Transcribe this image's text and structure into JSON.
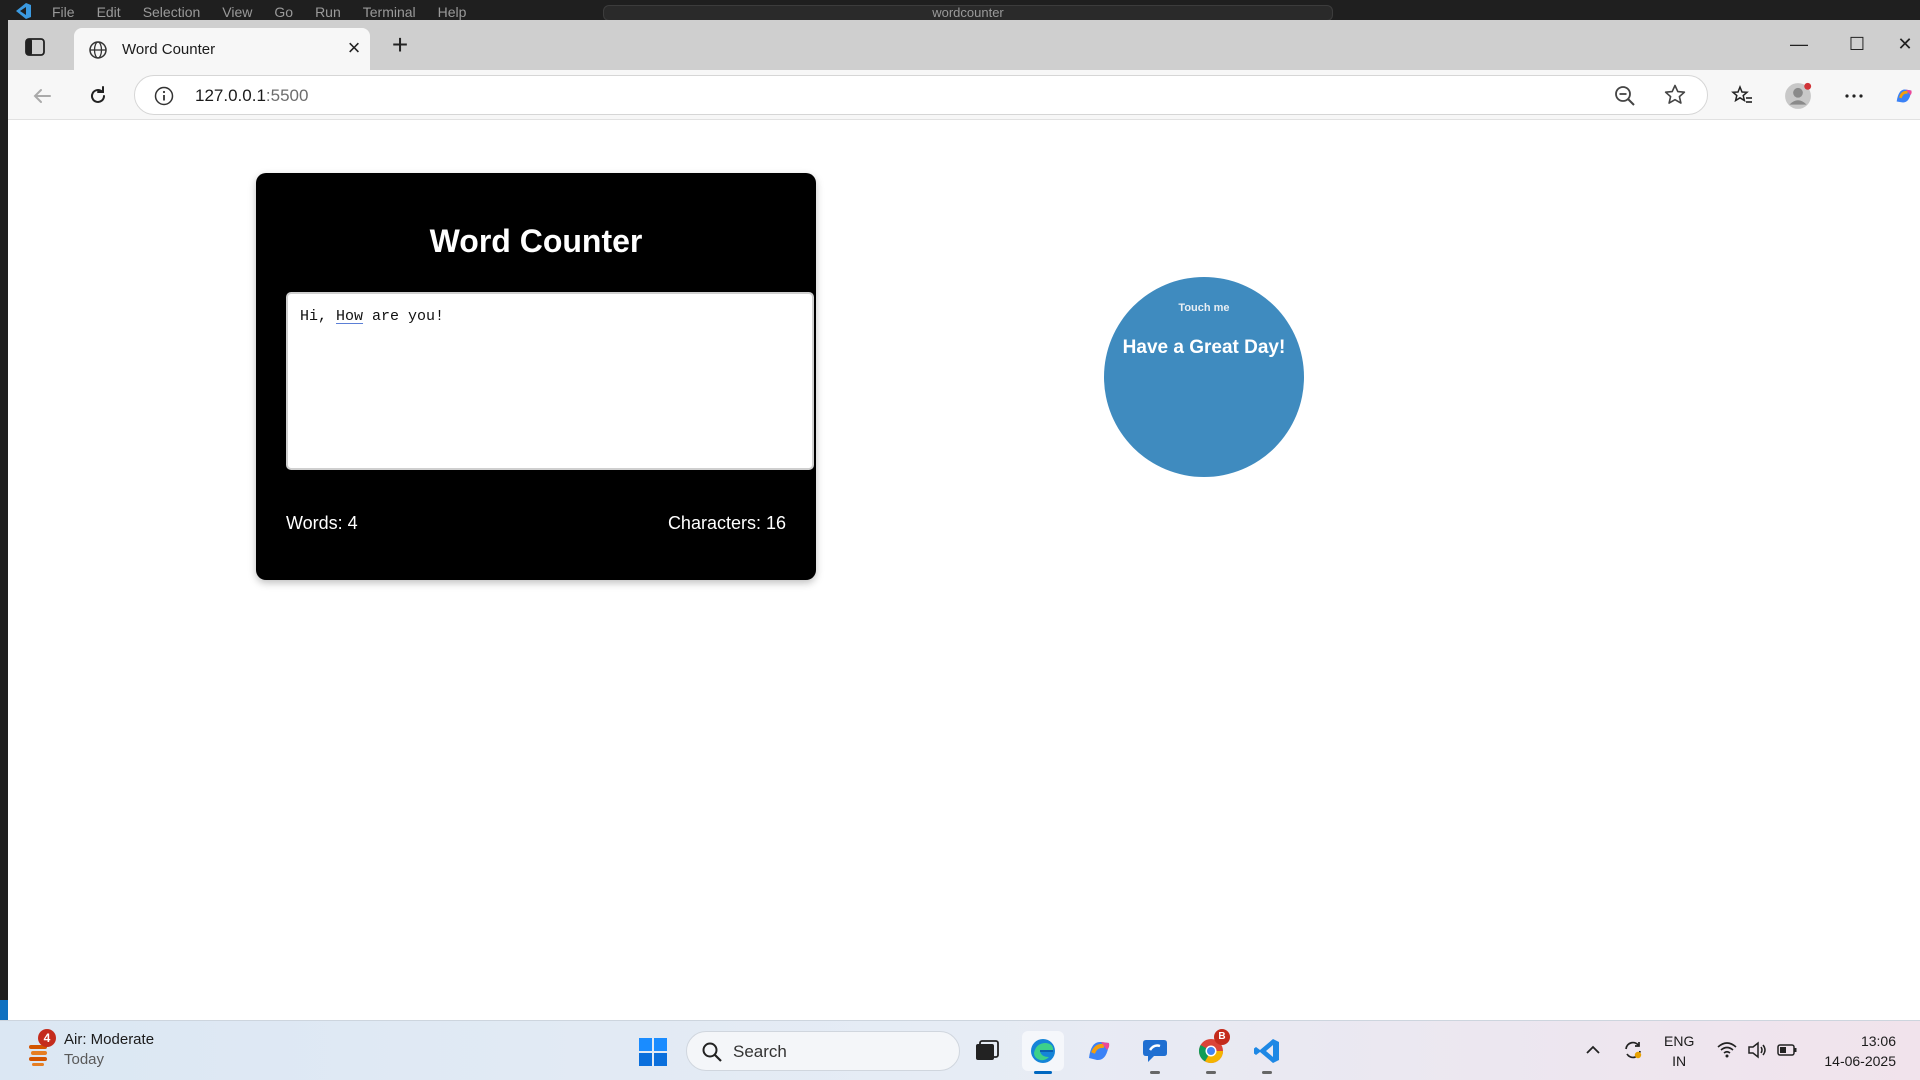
{
  "vscode": {
    "menu": [
      "File",
      "Edit",
      "Selection",
      "View",
      "Go",
      "Run",
      "Terminal",
      "Help"
    ],
    "search_text": "wordcounter"
  },
  "browser": {
    "tab_title": "Word Counter",
    "address_host": "127.0.0.1",
    "address_port": ":5500"
  },
  "page": {
    "card_title": "Word Counter",
    "textarea_value_pre": "Hi, ",
    "textarea_value_flag": "How",
    "textarea_value_post": " are you!",
    "words_stat": "Words: 4",
    "characters_stat": "Characters: 16",
    "circle_hint": "Touch me",
    "circle_message": "Have a Great Day!"
  },
  "taskbar": {
    "weather_badge": "4",
    "weather_title": "Air: Moderate",
    "weather_sub": "Today",
    "search_placeholder": "Search",
    "chrome_badge": "B",
    "lang_line1": "ENG",
    "lang_line2": "IN",
    "time": "13:06",
    "date": "14-06-2025"
  },
  "colors": {
    "card_bg": "#000000",
    "circle_bg": "#3f8bbf",
    "badge_red": "#c42b1c"
  }
}
